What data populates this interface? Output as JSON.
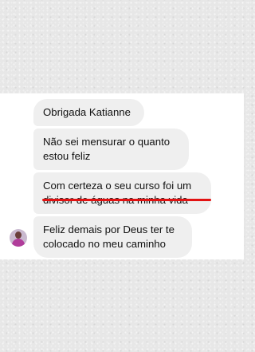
{
  "messages": [
    {
      "lines": [
        "Obrigada Katianne"
      ]
    },
    {
      "lines": [
        "Não sei mensurar o quanto",
        "estou feliz"
      ]
    },
    {
      "lines": [
        "Com certeza o seu curso foi um",
        "divisor de águas na minha vida"
      ]
    },
    {
      "lines": [
        "Feliz demais por Deus ter te",
        "colocado no meu caminho"
      ]
    }
  ],
  "highlight_color": "#e21212",
  "bubble_color": "#efefef"
}
